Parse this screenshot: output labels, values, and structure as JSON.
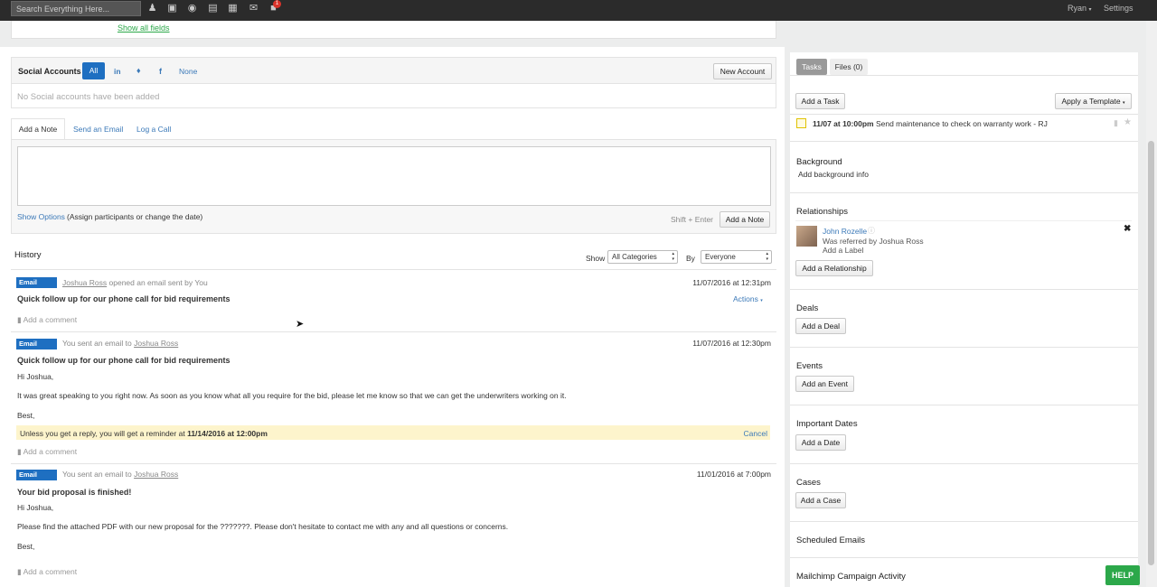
{
  "topbar": {
    "search_placeholder": "Search Everything Here...",
    "notification_count": "1",
    "user": "Ryan",
    "settings": "Settings"
  },
  "contact_fields": {
    "show_all": "Show all fields"
  },
  "social": {
    "title": "Social Accounts",
    "filters": [
      "All",
      "in",
      "t",
      "f",
      "None"
    ],
    "new_account": "New Account",
    "empty": "No Social accounts have been added"
  },
  "note_tabs": [
    "Add a Note",
    "Send an Email",
    "Log a Call"
  ],
  "note": {
    "show_options": "Show Options",
    "options_hint": "(Assign participants or change the date)",
    "shortcut": "Shift + Enter",
    "add_note": "Add a Note"
  },
  "history": {
    "title": "History",
    "show_label": "Show",
    "category": "All Categories",
    "by_label": "By",
    "person": "Everyone",
    "actions": "Actions",
    "add_comment": "Add a comment",
    "entries": [
      {
        "tag": "Email",
        "who": "Joshua Ross",
        "action": "opened an email sent by You",
        "date": "11/07/2016 at 12:31pm",
        "subject": "Quick follow up for our phone call for bid requirements"
      },
      {
        "tag": "Email",
        "who_prefix": "You sent an email to",
        "who": "Joshua Ross",
        "date": "11/07/2016 at 12:30pm",
        "subject": "Quick follow up for our phone call for bid requirements",
        "greeting": "Hi Joshua,",
        "body": "It was great speaking to you right now. As soon as you know what all you require for the bid, please let me know so that we can get the underwriters working on it.",
        "closing": "Best,",
        "reminder_prefix": "Unless you get a reply, you will get a reminder at",
        "reminder_date": "11/14/2016 at 12:00pm",
        "cancel": "Cancel"
      },
      {
        "tag": "Email",
        "who_prefix": "You sent an email to",
        "who": "Joshua Ross",
        "date": "11/01/2016 at 7:00pm",
        "subject": "Your bid proposal is finished!",
        "greeting": "Hi Joshua,",
        "body": "Please find the attached PDF with our new proposal for the ???????. Please don't hesitate to contact me with any and all questions or concerns.",
        "closing": "Best,"
      }
    ]
  },
  "sidebar": {
    "tabs": [
      "Tasks",
      "Files (0)"
    ],
    "add_task": "Add a Task",
    "apply_template": "Apply a Template",
    "task": {
      "when": "11/07 at 10:00pm",
      "text": "Send maintenance to check on warranty work - RJ"
    },
    "background_title": "Background",
    "background_link": "Add background info",
    "relationships_title": "Relationships",
    "relationship": {
      "name": "John Rozelle",
      "desc": "Was referred by Joshua Ross",
      "add_label": "Add a Label"
    },
    "add_relationship": "Add a Relationship",
    "deals_title": "Deals",
    "add_deal": "Add a Deal",
    "events_title": "Events",
    "add_event": "Add an Event",
    "dates_title": "Important Dates",
    "add_date": "Add a Date",
    "cases_title": "Cases",
    "add_case": "Add a Case",
    "scheduled_title": "Scheduled Emails",
    "mailchimp_title": "Mailchimp Campaign Activity",
    "help": "HELP"
  },
  "colors": {
    "accent": "#1e6fc1",
    "help": "#2ca84a",
    "topbar": "#2b2b2b",
    "reminder": "#fdf4cc"
  }
}
